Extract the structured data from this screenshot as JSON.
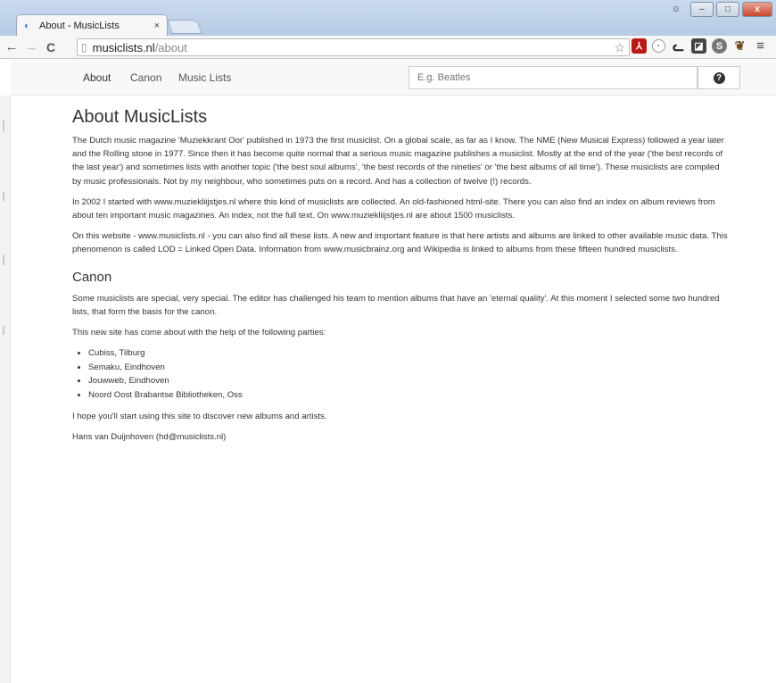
{
  "browser": {
    "tab_title": "About - MusicLists",
    "tab_close": "×",
    "url_host": "musiclists.nl",
    "url_path": "/about",
    "win_user_glyph": "☺",
    "win_min": "–",
    "win_max": "□",
    "win_close": "x",
    "icons": [
      "back-arrow",
      "forward-arrow",
      "reload",
      "page",
      "star",
      "acrobat",
      "globe",
      "cat",
      "square",
      "skype",
      "dog",
      "menu"
    ]
  },
  "site_nav": {
    "links": [
      "About",
      "Canon",
      "Music Lists"
    ],
    "search_placeholder": "E.g. Beatles",
    "help_glyph": "?"
  },
  "content": {
    "title": "About MusicLists",
    "paragraphs": [
      "The Dutch music magazine 'Muziekkrant Oor' published in 1973 the first musiclist. On a global scale, as far as I know. The NME (New Musical Express) followed a year later and the Rolling stone in 1977. Since then it has become quite normal that a serious music magazine publishes a musiclist. Mostly at the end of the year ('the best records of the last year') and sometimes lists with another topic ('the best soul albums', 'the best records of the nineties' or 'the best albums of all time'). These musiclists are compiled by music professionals. Not by my neighbour, who sometimes puts on a record. And has a collection of twelve (!) records.",
      "In 2002 I started with www.muziekliijstjes.nl where this kind of musiclists are collected. An old-fashioned html-site. There you can also find an index on album reviews from about ten important music magazines. An index, not the full text. On www.muziekliijstjes.nl are about 1500 musiclists.",
      "On this website - www.musiclists.nl - you can also find all these lists. A new and important feature is that here artists and albums are linked to other available music data. This phenomenon is called LOD = Linked Open Data. Information from www.musicbrainz.org and Wikipedia is linked to albums from these fifteen hundred musiclists."
    ],
    "canon_heading": "Canon",
    "canon_paragraphs": [
      "Some musiclists are special, very special. The editor has challenged his team to mention albums that have an 'eternal quality'. At this moment I selected some two hundred lists, that form the basis for the canon.",
      "This new site has come about with the help of the following parties:"
    ],
    "parties": [
      "Cubiss, Tilburg",
      "Semaku, Eindhoven",
      "Jouwweb, Eindhoven",
      "Noord Oost Brabantse Bibliotheken, Oss"
    ],
    "closing": "I hope you'll start using this site to discover new albums and artists.",
    "signature": "Hans van Duijnhoven (hd@musiclists.nl)"
  }
}
